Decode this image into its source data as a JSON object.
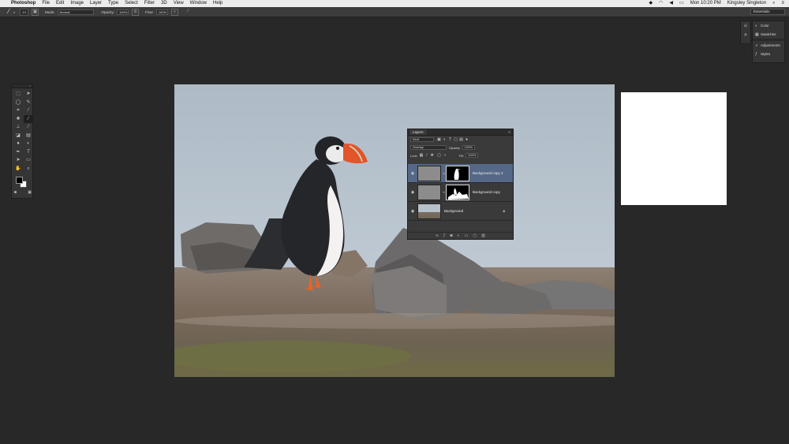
{
  "menubar": {
    "apple": "",
    "app": "Photoshop",
    "items": [
      "File",
      "Edit",
      "Image",
      "Layer",
      "Type",
      "Select",
      "Filter",
      "3D",
      "View",
      "Window",
      "Help"
    ],
    "clock": "Mon 10:20 PM",
    "user": "Kingsley Singleton"
  },
  "options": {
    "brush_size": "13",
    "mode_label": "Mode:",
    "mode_value": "Normal",
    "opacity_label": "Opacity:",
    "opacity_value": "100%",
    "flow_label": "Flow:",
    "flow_value": "100%",
    "workspace": "Essentials"
  },
  "layers_panel": {
    "tab": "Layers",
    "filter_kind": "Kind",
    "blend_mode": "Overlay",
    "opacity_label": "Opacity:",
    "opacity_value": "100%",
    "lock_label": "Lock:",
    "fill_label": "Fill:",
    "fill_value": "100%",
    "layers": [
      {
        "name": "Background copy 2",
        "active": true
      },
      {
        "name": "Background copy",
        "active": false
      },
      {
        "name": "Background",
        "active": false
      }
    ]
  },
  "right_panels": {
    "items": [
      "Color",
      "Swatches",
      "Adjustments",
      "Styles"
    ]
  },
  "colors": {
    "workspace_bg": "#282828",
    "panel_bg": "#3a3a3a",
    "active_layer": "#566887"
  }
}
